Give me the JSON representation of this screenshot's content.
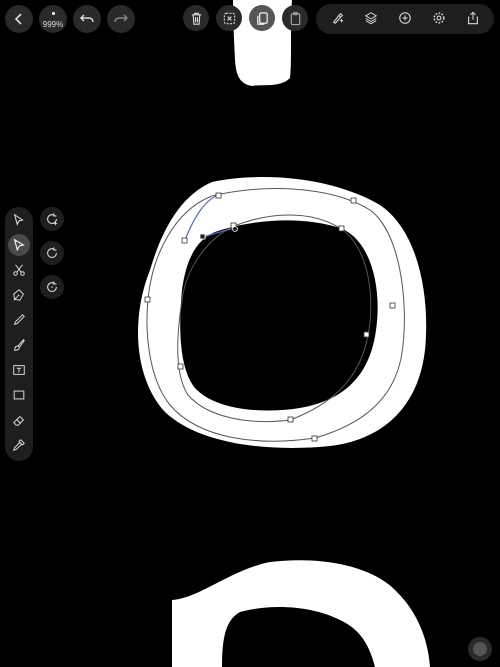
{
  "toolbar": {
    "zoom_label": "999%",
    "back_icon": "chevron-left-icon",
    "undo_icon": "undo-icon",
    "redo_icon": "redo-icon",
    "trash_icon": "trash-icon",
    "deselect_icon": "deselect-icon",
    "duplicate_icon": "duplicate-icon",
    "paste_icon": "paste-icon",
    "right_icons": [
      "brush-settings-icon",
      "layers-icon",
      "add-icon",
      "settings-icon",
      "share-icon"
    ]
  },
  "tools": [
    "select-arrow-icon",
    "direct-select-icon",
    "scissors-icon",
    "pen-icon",
    "pencil-icon",
    "brush-icon",
    "text-icon",
    "rectangle-icon",
    "eraser-icon",
    "eyedropper-icon"
  ],
  "rotate_tools": [
    "rotate-plus-icon",
    "rotate-cw-icon",
    "rotate-ccw-icon"
  ],
  "colors": {
    "background": "#000000",
    "panel": "#1e1e1e",
    "path": "#5a6aa8",
    "shape": "#ffffff"
  }
}
